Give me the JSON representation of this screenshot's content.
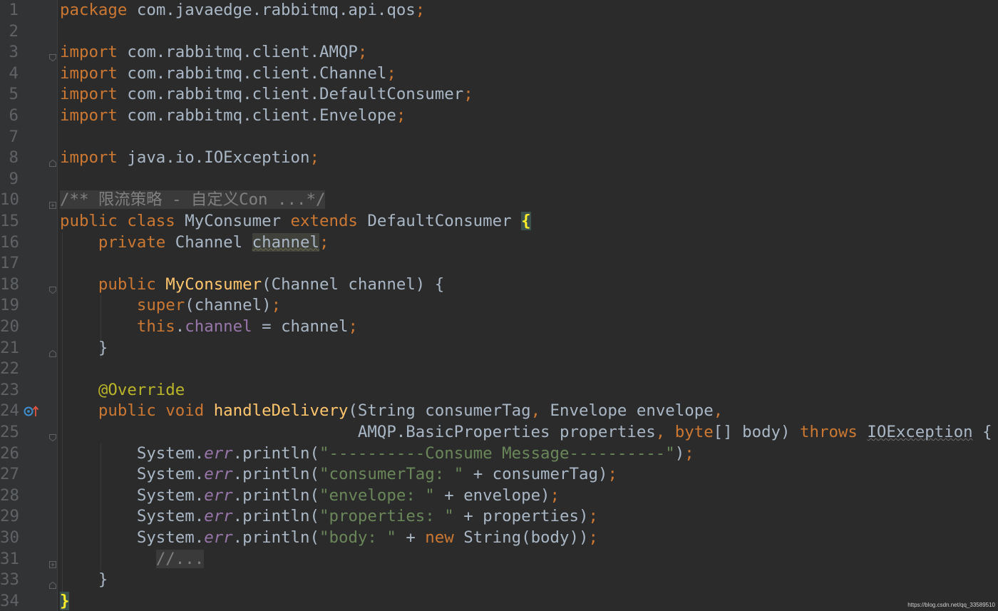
{
  "editor": {
    "language": "java",
    "file_class": "MyConsumer",
    "watermark": "https://blog.csdn.net/qq_33589510"
  },
  "lines": [
    {
      "n": "1",
      "tokens": [
        [
          "kw",
          "package"
        ],
        [
          "pl",
          " com.javaedge.rabbitmq.api.qos"
        ],
        [
          "kw",
          ";"
        ]
      ]
    },
    {
      "n": "2",
      "tokens": []
    },
    {
      "n": "3",
      "fold": "open",
      "tokens": [
        [
          "kw",
          "import"
        ],
        [
          "pl",
          " com.rabbitmq.client.AMQP"
        ],
        [
          "kw",
          ";"
        ]
      ]
    },
    {
      "n": "4",
      "tokens": [
        [
          "kw",
          "import"
        ],
        [
          "pl",
          " com.rabbitmq.client.Channel"
        ],
        [
          "kw",
          ";"
        ]
      ]
    },
    {
      "n": "5",
      "tokens": [
        [
          "kw",
          "import"
        ],
        [
          "pl",
          " com.rabbitmq.client.DefaultConsumer"
        ],
        [
          "kw",
          ";"
        ]
      ]
    },
    {
      "n": "6",
      "tokens": [
        [
          "kw",
          "import"
        ],
        [
          "pl",
          " com.rabbitmq.client.Envelope"
        ],
        [
          "kw",
          ";"
        ]
      ]
    },
    {
      "n": "7",
      "tokens": []
    },
    {
      "n": "8",
      "fold": "close",
      "tokens": [
        [
          "kw",
          "import"
        ],
        [
          "pl",
          " java.io.IOException"
        ],
        [
          "kw",
          ";"
        ]
      ]
    },
    {
      "n": "9",
      "tokens": []
    },
    {
      "n": "10",
      "fold": "plus",
      "tokens": [
        [
          "cmf",
          "/** 限流策略 - 自定义Con ...*/"
        ]
      ]
    },
    {
      "n": "15",
      "tokens": [
        [
          "kw",
          "public class "
        ],
        [
          "pl",
          "MyConsumer "
        ],
        [
          "kw",
          "extends "
        ],
        [
          "pl",
          "DefaultConsumer "
        ],
        [
          "brace",
          "{"
        ]
      ]
    },
    {
      "n": "16",
      "tokens": [
        [
          "pl",
          "    "
        ],
        [
          "kw",
          "private "
        ],
        [
          "pl",
          "Channel "
        ],
        [
          "hl",
          "channel"
        ],
        [
          "kw",
          ";"
        ]
      ]
    },
    {
      "n": "17",
      "tokens": []
    },
    {
      "n": "18",
      "fold": "open",
      "tokens": [
        [
          "pl",
          "    "
        ],
        [
          "kw",
          "public "
        ],
        [
          "fn",
          "MyConsumer"
        ],
        [
          "pl",
          "(Channel channel) {"
        ]
      ]
    },
    {
      "n": "19",
      "tokens": [
        [
          "pl",
          "        "
        ],
        [
          "kw",
          "super"
        ],
        [
          "pl",
          "(channel)"
        ],
        [
          "kw",
          ";"
        ]
      ]
    },
    {
      "n": "20",
      "tokens": [
        [
          "pl",
          "        "
        ],
        [
          "kw",
          "this"
        ],
        [
          "pl",
          "."
        ],
        [
          "fd",
          "channel"
        ],
        [
          "pl",
          " = channel"
        ],
        [
          "kw",
          ";"
        ]
      ]
    },
    {
      "n": "21",
      "fold": "close",
      "tokens": [
        [
          "pl",
          "    }"
        ]
      ]
    },
    {
      "n": "22",
      "tokens": []
    },
    {
      "n": "23",
      "tokens": [
        [
          "pl",
          "    "
        ],
        [
          "an",
          "@Override"
        ]
      ]
    },
    {
      "n": "24",
      "mark": "override",
      "tokens": [
        [
          "pl",
          "    "
        ],
        [
          "kw",
          "public void "
        ],
        [
          "fn",
          "handleDelivery"
        ],
        [
          "pl",
          "(String consumerTag"
        ],
        [
          "kw",
          ", "
        ],
        [
          "pl",
          "Envelope envelope"
        ],
        [
          "kw",
          ","
        ]
      ]
    },
    {
      "n": "25",
      "fold": "open",
      "tokens": [
        [
          "pl",
          "                               AMQP.BasicProperties properties"
        ],
        [
          "kw",
          ", "
        ],
        [
          "kw",
          "byte"
        ],
        [
          "pl",
          "[] body) "
        ],
        [
          "kw",
          "throws "
        ],
        [
          "wv",
          "IOException"
        ],
        [
          "pl",
          " {"
        ]
      ]
    },
    {
      "n": "26",
      "tokens": [
        [
          "pl",
          "        System."
        ],
        [
          "sf",
          "err"
        ],
        [
          "pl",
          ".println("
        ],
        [
          "st",
          "\"----------Consume Message----------\""
        ],
        [
          "pl",
          ")"
        ],
        [
          "kw",
          ";"
        ]
      ]
    },
    {
      "n": "27",
      "tokens": [
        [
          "pl",
          "        System."
        ],
        [
          "sf",
          "err"
        ],
        [
          "pl",
          ".println("
        ],
        [
          "st",
          "\"consumerTag: \""
        ],
        [
          "pl",
          " + consumerTag)"
        ],
        [
          "kw",
          ";"
        ]
      ]
    },
    {
      "n": "28",
      "tokens": [
        [
          "pl",
          "        System."
        ],
        [
          "sf",
          "err"
        ],
        [
          "pl",
          ".println("
        ],
        [
          "st",
          "\"envelope: \""
        ],
        [
          "pl",
          " + envelope)"
        ],
        [
          "kw",
          ";"
        ]
      ]
    },
    {
      "n": "29",
      "tokens": [
        [
          "pl",
          "        System."
        ],
        [
          "sf",
          "err"
        ],
        [
          "pl",
          ".println("
        ],
        [
          "st",
          "\"properties: \""
        ],
        [
          "pl",
          " + properties)"
        ],
        [
          "kw",
          ";"
        ]
      ]
    },
    {
      "n": "30",
      "tokens": [
        [
          "pl",
          "        System."
        ],
        [
          "sf",
          "err"
        ],
        [
          "pl",
          ".println("
        ],
        [
          "st",
          "\"body: \""
        ],
        [
          "pl",
          " + "
        ],
        [
          "kw",
          "new "
        ],
        [
          "pl",
          "String(body))"
        ],
        [
          "kw",
          ";"
        ]
      ]
    },
    {
      "n": "31",
      "fold": "plus",
      "tokens": [
        [
          "pl",
          "          "
        ],
        [
          "cmf",
          "//..."
        ]
      ]
    },
    {
      "n": "33",
      "fold": "close",
      "tokens": [
        [
          "pl",
          "    }"
        ]
      ]
    },
    {
      "n": "34",
      "tokens": [
        [
          "brace",
          "}"
        ]
      ]
    }
  ]
}
